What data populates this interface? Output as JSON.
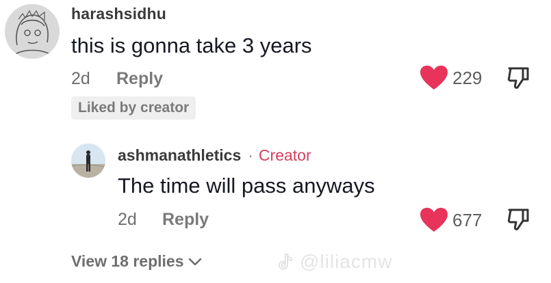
{
  "comment": {
    "username": "harashsidhu",
    "text": "this is gonna take 3 years",
    "time": "2d",
    "reply_label": "Reply",
    "liked_badge": "Liked by creator",
    "likes": "229",
    "avatar_icon": "sketch-avatar-icon"
  },
  "reply": {
    "username": "ashmanathletics",
    "separator": "·",
    "creator_label": "Creator",
    "text": "The time will pass anyways",
    "time": "2d",
    "reply_label": "Reply",
    "likes": "677",
    "avatar_icon": "person-photo-avatar-icon"
  },
  "view_replies": {
    "label": "View 18 replies"
  },
  "watermark": {
    "text": "@liliacmw"
  },
  "colors": {
    "heart": "#e8335a",
    "creator": "#d43f5c",
    "muted": "#7a7a7a"
  }
}
